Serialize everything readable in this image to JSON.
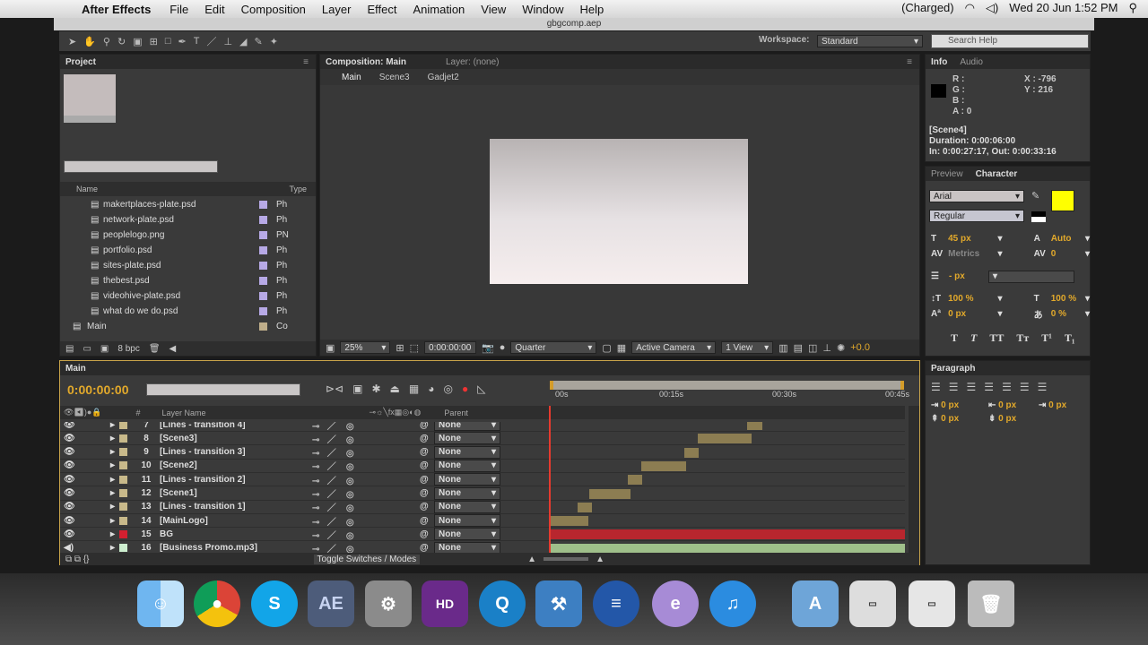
{
  "menubar": {
    "app": "After Effects",
    "items": [
      "File",
      "Edit",
      "Composition",
      "Layer",
      "Effect",
      "Animation",
      "View",
      "Window",
      "Help"
    ],
    "battery": "(Charged)",
    "datetime": "Wed 20 Jun  1:52 PM"
  },
  "title": "gbgcomp.aep",
  "toolbar": {
    "workspace_label": "Workspace:",
    "workspace": "Standard",
    "search_placeholder": "Search Help"
  },
  "project": {
    "tab": "Project",
    "col_name": "Name",
    "col_type": "Type",
    "items": [
      {
        "name": "makertplaces-plate.psd",
        "type": "Ph",
        "color": "#b7a9e6"
      },
      {
        "name": "network-plate.psd",
        "type": "Ph",
        "color": "#b7a9e6"
      },
      {
        "name": "peoplelogo.png",
        "type": "PN",
        "color": "#b7a9e6"
      },
      {
        "name": "portfolio.psd",
        "type": "Ph",
        "color": "#b7a9e6"
      },
      {
        "name": "sites-plate.psd",
        "type": "Ph",
        "color": "#b7a9e6"
      },
      {
        "name": "thebest.psd",
        "type": "Ph",
        "color": "#b7a9e6"
      },
      {
        "name": "videohive-plate.psd",
        "type": "Ph",
        "color": "#b7a9e6"
      },
      {
        "name": "what do we do.psd",
        "type": "Ph",
        "color": "#b7a9e6"
      },
      {
        "name": "Main",
        "type": "Co",
        "color": "#bfae8a"
      }
    ],
    "bpc": "8 bpc"
  },
  "comp": {
    "tab": "Composition: Main",
    "layer_tab": "Layer: (none)",
    "breadcrumbs": [
      "Main",
      "Scene3",
      "Gadjet2"
    ],
    "zoom": "25%",
    "time": "0:00:00:00",
    "resolution": "Quarter",
    "camera": "Active Camera",
    "views": "1 View",
    "exposure": "+0.0"
  },
  "info": {
    "tab": "Info",
    "tab2": "Audio",
    "r": "R :",
    "g": "G :",
    "b": "B :",
    "a": "A : 0",
    "x": "X : -796",
    "y": "Y : 216",
    "layer": "[Scene4]",
    "duration": "Duration: 0:00:06:00",
    "inout": "In: 0:00:27:17, Out: 0:00:33:16"
  },
  "character": {
    "tab": "Preview",
    "tab2": "Character",
    "font": "Arial",
    "style": "Regular",
    "size": "45 px",
    "leading": "Auto",
    "kerning": "Metrics",
    "tracking": "0",
    "stroke": "- px",
    "vscale": "100 %",
    "hscale": "100 %",
    "baseline": "0 px",
    "tsume": "0 %",
    "fill_color": "#ffff00",
    "styles": [
      "T",
      "T",
      "TT",
      "Tт",
      "T¹",
      "T₁"
    ]
  },
  "timeline": {
    "tab": "Main",
    "timecode": "0:00:00:00",
    "col_layer": "Layer Name",
    "col_parent": "Parent",
    "ruler": [
      "00s",
      "00:15s",
      "00:30s",
      "00:45s"
    ],
    "toggle": "Toggle Switches / Modes",
    "layers": [
      {
        "num": "7",
        "name": "[Lines - transition 4]",
        "color": "#c8b98a",
        "parent": "None",
        "in": 26,
        "out": 28,
        "bar": "#8c7d52"
      },
      {
        "num": "8",
        "name": "[Scene3]",
        "color": "#c8b98a",
        "parent": "None",
        "in": 19.4,
        "out": 26.5,
        "bar": "#8c7d52"
      },
      {
        "num": "9",
        "name": "[Lines - transition 3]",
        "color": "#c8b98a",
        "parent": "None",
        "in": 17.7,
        "out": 19.6,
        "bar": "#8c7d52"
      },
      {
        "num": "10",
        "name": "[Scene2]",
        "color": "#c8b98a",
        "parent": "None",
        "in": 12,
        "out": 17.9,
        "bar": "#8c7d52"
      },
      {
        "num": "11",
        "name": "[Lines - transition 2]",
        "color": "#c8b98a",
        "parent": "None",
        "in": 10.2,
        "out": 12.1,
        "bar": "#8c7d52"
      },
      {
        "num": "12",
        "name": "[Scene1]",
        "color": "#c8b98a",
        "parent": "None",
        "in": 5.1,
        "out": 10.5,
        "bar": "#8c7d52"
      },
      {
        "num": "13",
        "name": "[Lines - transition 1]",
        "color": "#c8b98a",
        "parent": "None",
        "in": 3.6,
        "out": 5.4,
        "bar": "#8c7d52"
      },
      {
        "num": "14",
        "name": "[MainLogo]",
        "color": "#c8b98a",
        "parent": "None",
        "in": 0,
        "out": 5,
        "bar": "#8c7d52"
      },
      {
        "num": "15",
        "name": "BG",
        "color": "#d42030",
        "parent": "None",
        "in": 0,
        "out": 47,
        "bar": "#b8262e"
      },
      {
        "num": "16",
        "name": "[Business Promo.mp3]",
        "color": "#cdeecf",
        "parent": "None",
        "in": 0,
        "out": 47,
        "bar": "#9fbf8a"
      }
    ]
  },
  "paragraph": {
    "tab": "Paragraph",
    "indent1": "0 px",
    "indent2": "0 px",
    "indent3": "0 px",
    "space1": "0 px",
    "space2": "0 px"
  }
}
